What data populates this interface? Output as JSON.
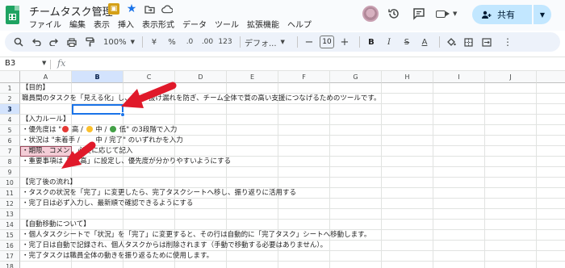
{
  "app": {
    "title": "チームタスク管理",
    "menu": [
      "ファイル",
      "編集",
      "表示",
      "挿入",
      "表示形式",
      "データ",
      "ツール",
      "拡張機能",
      "ヘルプ"
    ],
    "share_label": "共有",
    "colors": {
      "accent": "#1a73e8",
      "share_bg": "#c2e7ff",
      "logo": "#1ea362"
    }
  },
  "toolbar": {
    "zoom": "100%",
    "currency": "¥",
    "percent": "%",
    "dec_decrease": ".0",
    "dec_increase": ".00",
    "number_format": "123",
    "font_family": "デフォ...",
    "font_size": "10",
    "bold": "B"
  },
  "formula_bar": {
    "name_box": "B3",
    "fx": "fx",
    "value": ""
  },
  "sheet": {
    "columns": [
      "A",
      "B",
      "C",
      "D",
      "E",
      "F",
      "G",
      "H",
      "I",
      "J"
    ],
    "selected_column": "B",
    "selected_row": "3",
    "rows": [
      {
        "n": "1",
        "text": "【目的】"
      },
      {
        "n": "2",
        "text": "職員間のタスクを「見える化」し、　　の抜け漏れを防ぎ、チーム全体で質の高い支援につなげるためのツールです。"
      },
      {
        "n": "3",
        "text": ""
      },
      {
        "n": "4",
        "text": "【入力ルール】"
      },
      {
        "n": "5",
        "pre": "・優先度は \"",
        "p1": " 高 / ",
        "p2": " 中 / ",
        "post": " 低\" の3段階で入力"
      },
      {
        "n": "6",
        "text": "・状況は \"未着手 / 　　中 / 完了\" のいずれかを入力"
      },
      {
        "n": "7",
        "text": "・期限、コメン",
        "rest": "必要に応じて記入"
      },
      {
        "n": "8",
        "pre": "・重要事項は「",
        "post": " 高」に設定し、優先度が分かりやすいようにする"
      },
      {
        "n": "9",
        "text": ""
      },
      {
        "n": "10",
        "text": "【完了後の流れ】"
      },
      {
        "n": "11",
        "text": "・タスクの状況を「完了」に変更したら、完了タスクシートへ移し、振り返りに活用する"
      },
      {
        "n": "12",
        "text": "・完了日は必ず入力し、最新順で確認できるようにする"
      },
      {
        "n": "13",
        "text": ""
      },
      {
        "n": "14",
        "text": "【自動移動について】"
      },
      {
        "n": "15",
        "text": "・個人タスクシートで「状況」を「完了」に変更すると、その行は自動的に「完了タスク」シートへ移動します。"
      },
      {
        "n": "16",
        "text": "・完了日は自動で記録され、個人タスクからは削除されます（手動で移動する必要はありません）。"
      },
      {
        "n": "17",
        "text": "・完了タスクは職員全体の動きを振り返るために使用します。"
      },
      {
        "n": "18",
        "text": ""
      }
    ]
  }
}
